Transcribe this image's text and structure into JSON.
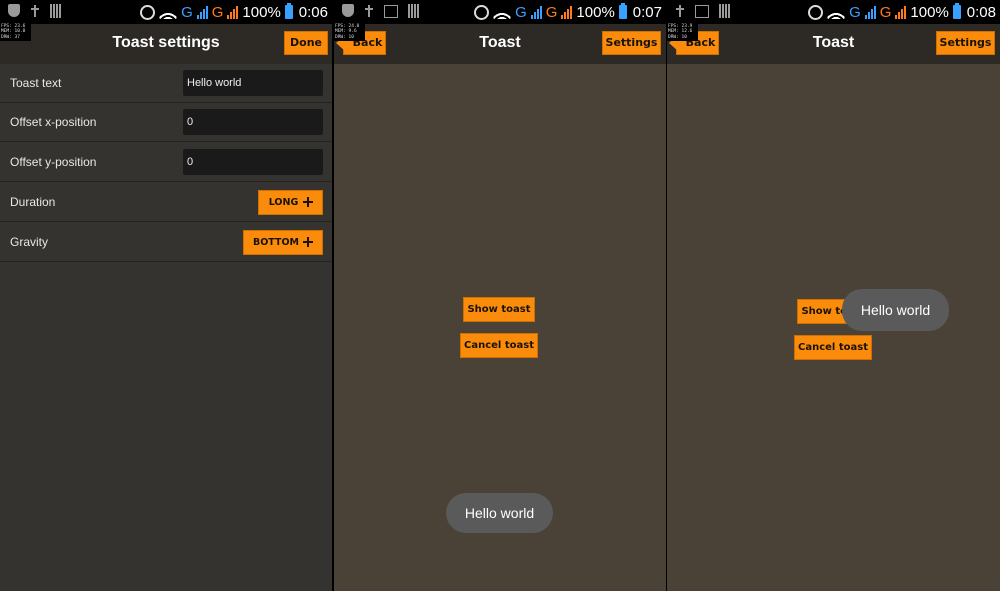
{
  "status_bars": [
    {
      "battery": "100%",
      "time": "0:06",
      "left_icons": [
        "shield-icon",
        "usb-icon",
        "bars-icon"
      ],
      "net_types": [
        "G",
        "G"
      ]
    },
    {
      "battery": "100%",
      "time": "0:07",
      "left_icons": [
        "shield-icon",
        "usb-icon",
        "image-icon",
        "bars-icon"
      ],
      "net_types": [
        "G",
        "G"
      ]
    },
    {
      "battery": "100%",
      "time": "0:08",
      "left_icons": [
        "usb-icon",
        "image-icon",
        "bars-icon"
      ],
      "net_types": [
        "G",
        "G"
      ]
    }
  ],
  "debug_overlays": [
    {
      "fps": "FPS: 23.6",
      "mem": "MEM: 10.8",
      "drw": "DRW: 37"
    },
    {
      "fps": "FPS: 24.0",
      "mem": "MEM: 9.6",
      "drw": "DRW: 10"
    },
    {
      "fps": "FPS: 23.9",
      "mem": "MEM: 12.6",
      "drw": "DRW: 10"
    }
  ],
  "settings_screen": {
    "title": "Toast settings",
    "done_label": "Done",
    "rows": [
      {
        "label": "Toast text",
        "value": "Hello world"
      },
      {
        "label": "Offset x-position",
        "value": "0"
      },
      {
        "label": "Offset y-position",
        "value": "0"
      },
      {
        "label": "Duration",
        "value": "LONG"
      },
      {
        "label": "Gravity",
        "value": "BOTTOM"
      }
    ]
  },
  "toast_screens": [
    {
      "title": "Toast",
      "back_label": "Back",
      "settings_label": "Settings",
      "show_label": "Show toast",
      "cancel_label": "Cancel toast",
      "toast_text": "Hello world",
      "toast_position": "bottom"
    },
    {
      "title": "Toast",
      "back_label": "Back",
      "settings_label": "Settings",
      "show_label": "Show toast",
      "cancel_label": "Cancel toast",
      "toast_text": "Hello world",
      "toast_position": "center"
    }
  ],
  "colors": {
    "accent": "#fb8c0b",
    "settings_bg": "#353330",
    "toast_bg": "#4a4137",
    "toast_bubble": "#5a5a5a",
    "net_blue": "#3aa0ff",
    "net_orange": "#ff7a1a"
  }
}
